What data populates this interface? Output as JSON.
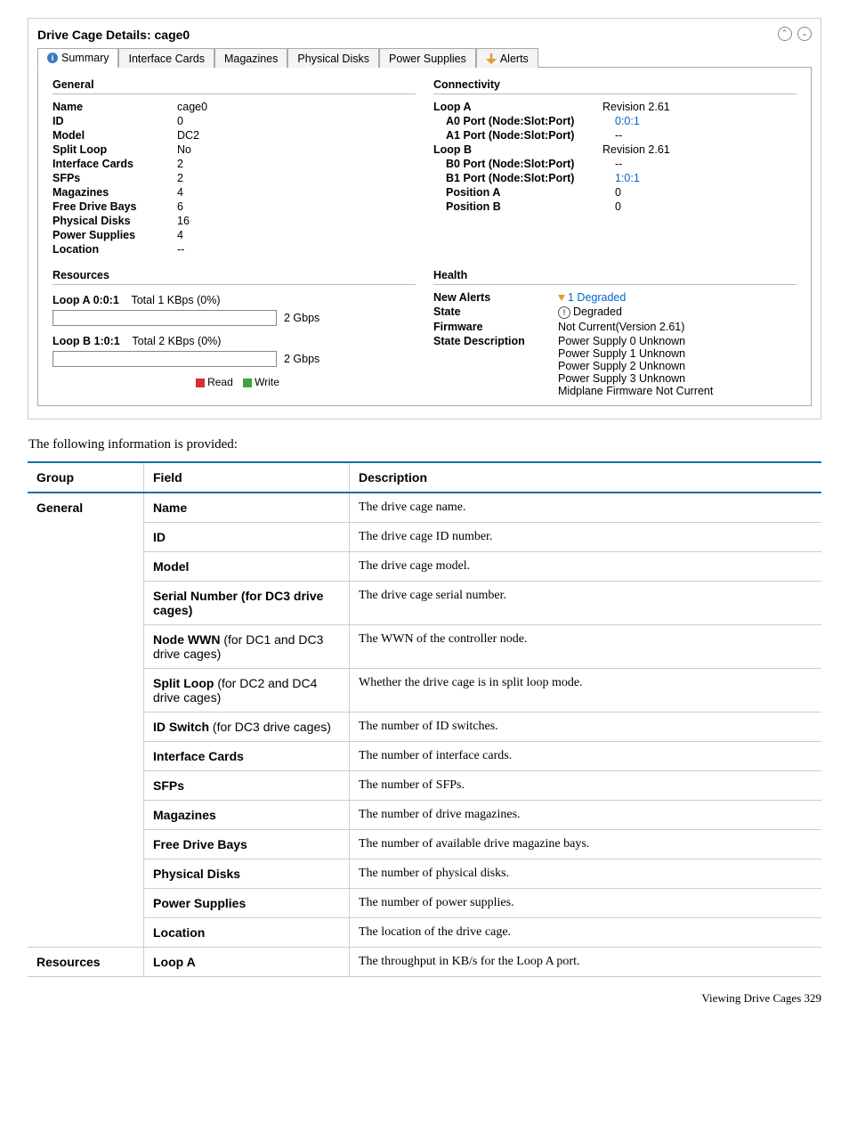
{
  "panel": {
    "title": "Drive Cage Details: cage0"
  },
  "tabs": {
    "summary": "Summary",
    "interface": "Interface Cards",
    "magazines": "Magazines",
    "pdisks": "Physical Disks",
    "psupplies": "Power Supplies",
    "alerts": "Alerts"
  },
  "general": {
    "head": "General",
    "labels": {
      "name": "Name",
      "id": "ID",
      "model": "Model",
      "splitloop": "Split Loop",
      "ifcards": "Interface Cards",
      "sfps": "SFPs",
      "mags": "Magazines",
      "fdb": "Free Drive Bays",
      "pdisks": "Physical Disks",
      "psup": "Power Supplies",
      "loc": "Location"
    },
    "values": {
      "name": "cage0",
      "id": "0",
      "model": "DC2",
      "splitloop": "No",
      "ifcards": "2",
      "sfps": "2",
      "mags": "4",
      "fdb": "6",
      "pdisks": "16",
      "psup": "4",
      "loc": "--"
    }
  },
  "conn": {
    "head": "Connectivity",
    "loopa": "Loop A",
    "loopa_rev": "Revision 2.61",
    "a0": "A0 Port (Node:Slot:Port)",
    "a0v": "0:0:1",
    "a1": "A1 Port (Node:Slot:Port)",
    "a1v": "--",
    "loopb": "Loop B",
    "loopb_rev": "Revision 2.61",
    "b0": "B0 Port (Node:Slot:Port)",
    "b0v": "--",
    "b1": "B1 Port (Node:Slot:Port)",
    "b1v": "1:0:1",
    "posa": "Position A",
    "posav": "0",
    "posb": "Position B",
    "posbv": "0"
  },
  "resources": {
    "head": "Resources",
    "loopa_label": "Loop A 0:0:1",
    "loopa_stat": "Total 1 KBps (0%)",
    "loopa_cap": "2 Gbps",
    "loopb_label": "Loop B 1:0:1",
    "loopb_stat": "Total 2 KBps (0%)",
    "loopb_cap": "2 Gbps",
    "legend_read": "Read",
    "legend_write": "Write"
  },
  "health": {
    "head": "Health",
    "new_alerts_l": "New Alerts",
    "new_alerts_v": "1 Degraded",
    "state_l": "State",
    "state_v": "Degraded",
    "fw_l": "Firmware",
    "fw_v": "Not Current(Version 2.61)",
    "sd_l": "State Description",
    "sd_v1": "Power Supply 0 Unknown",
    "sd_v2": "Power Supply 1 Unknown",
    "sd_v3": "Power Supply 2 Unknown",
    "sd_v4": "Power Supply 3 Unknown",
    "sd_v5": "Midplane Firmware Not Current"
  },
  "intro": "The following information is provided:",
  "table": {
    "head_group": "Group",
    "head_field": "Field",
    "head_desc": "Description",
    "g_general": "General",
    "g_resources": "Resources",
    "r1f": "Name",
    "r1d": "The drive cage name.",
    "r2f": "ID",
    "r2d": "The drive cage ID number.",
    "r3f": "Model",
    "r3d": "The drive cage model.",
    "r4f": "Serial Number (for DC3 drive cages)",
    "r4d": "The drive cage serial number.",
    "r5f": "Node WWN",
    "r5note": " (for DC1 and DC3 drive cages)",
    "r5d": "The WWN of the controller node.",
    "r6f": "Split Loop",
    "r6note": " (for DC2 and DC4 drive cages)",
    "r6d": "Whether the drive cage is in split loop mode.",
    "r7f": "ID Switch",
    "r7note": " (for DC3 drive cages)",
    "r7d": "The number of ID switches.",
    "r8f": "Interface Cards",
    "r8d": "The number of interface cards.",
    "r9f": "SFPs",
    "r9d": "The number of SFPs.",
    "r10f": "Magazines",
    "r10d": "The number of drive magazines.",
    "r11f": "Free Drive Bays",
    "r11d": "The number of available drive magazine bays.",
    "r12f": "Physical Disks",
    "r12d": "The number of physical disks.",
    "r13f": "Power Supplies",
    "r13d": "The number of power supplies.",
    "r14f": "Location",
    "r14d": "The location of the drive cage.",
    "r15f": "Loop A",
    "r15d": "The throughput in KB/s for the Loop A port."
  },
  "footer": "Viewing Drive Cages   329"
}
